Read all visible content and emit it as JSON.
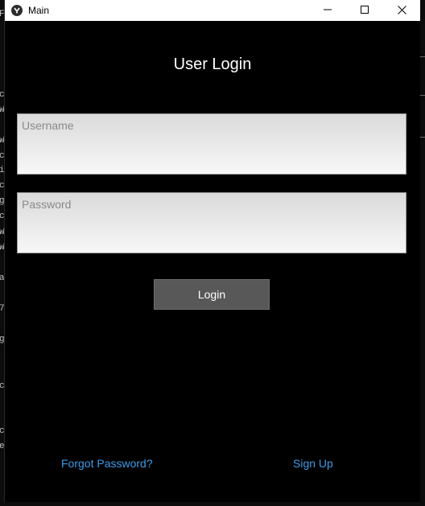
{
  "window": {
    "title": "Main",
    "controls": {
      "minimize_icon": "minimize-icon",
      "maximize_icon": "maximize-icon",
      "close_icon": "close-icon"
    }
  },
  "login": {
    "heading": "User Login",
    "username": {
      "value": "",
      "placeholder": "Username"
    },
    "password": {
      "value": "",
      "placeholder": "Password"
    },
    "login_button": "Login",
    "forgot_password_link": "Forgot Password?",
    "sign_up_link": "Sign Up"
  },
  "colors": {
    "window_background": "#000000",
    "button_background": "#585858",
    "link_color": "#3d9be9",
    "field_background": "#e6e6e6"
  }
}
